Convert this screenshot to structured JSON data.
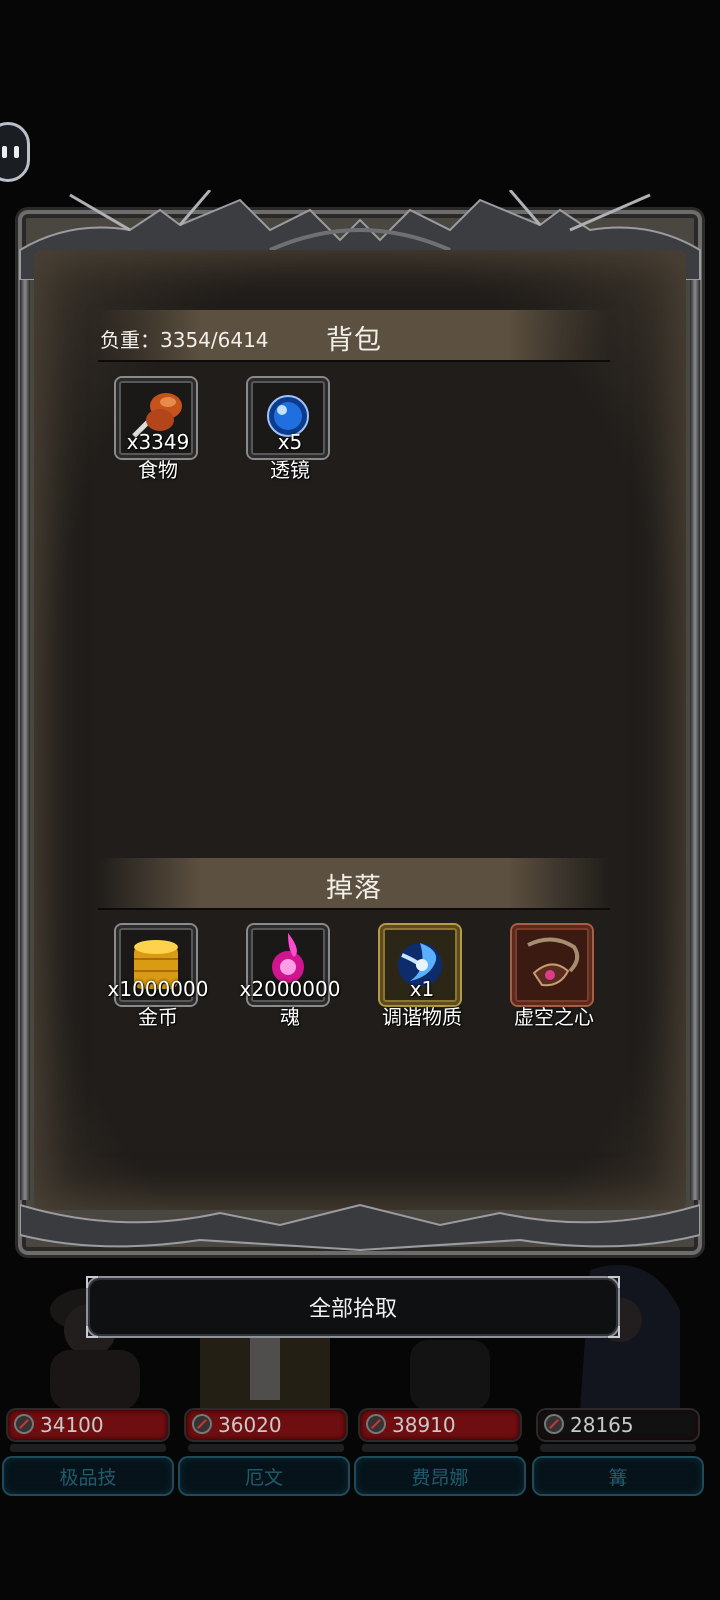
{
  "inventory": {
    "title": "背包",
    "weight_label": "负重：3354/6414",
    "items": [
      {
        "icon": "drumstick-food-icon",
        "count": "x3349",
        "name": "食物"
      },
      {
        "icon": "blue-lens-orb-icon",
        "count": "x5",
        "name": "透镜"
      }
    ]
  },
  "drops": {
    "title": "掉落",
    "items": [
      {
        "icon": "gold-coin-stack-icon",
        "count": "x1000000",
        "name": "金币",
        "frame": "gray"
      },
      {
        "icon": "pink-soul-flame-icon",
        "count": "x2000000",
        "name": "魂",
        "frame": "gray"
      },
      {
        "icon": "blue-vortex-matter-icon",
        "count": "x1",
        "name": "调谐物质",
        "frame": "gold"
      },
      {
        "icon": "void-heart-amulet-icon",
        "count": "",
        "name": "虚空之心",
        "frame": "red"
      }
    ]
  },
  "pickup_all_label": "全部拾取",
  "party": [
    {
      "hp": "34100",
      "name": "极品技"
    },
    {
      "hp": "36020",
      "name": "厄文"
    },
    {
      "hp": "38910",
      "name": "费昂娜"
    },
    {
      "hp": "28165",
      "name": "篝"
    }
  ],
  "colors": {
    "panel_bg": "#201d1a",
    "header_band": "#5c5040",
    "hp_red": "#6e0e10",
    "name_teal": "#1f5b6c"
  }
}
